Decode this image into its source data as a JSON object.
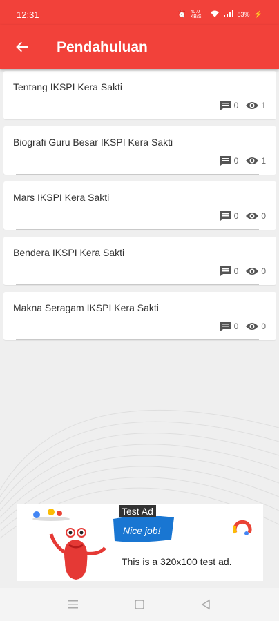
{
  "status_bar": {
    "time": "12:31",
    "battery": "83%",
    "speed": "40.0 KB/S"
  },
  "app_bar": {
    "title": "Pendahuluan"
  },
  "items": [
    {
      "title": "Tentang IKSPI Kera Sakti",
      "comments": "0",
      "views": "1"
    },
    {
      "title": "Biografi Guru Besar IKSPI Kera Sakti",
      "comments": "0",
      "views": "1"
    },
    {
      "title": "Mars IKSPI Kera Sakti",
      "comments": "0",
      "views": "0"
    },
    {
      "title": "Bendera IKSPI Kera Sakti",
      "comments": "0",
      "views": "0"
    },
    {
      "title": "Makna Seragam IKSPI Kera Sakti",
      "comments": "0",
      "views": "0"
    }
  ],
  "ad": {
    "badge": "Test Ad",
    "text": "This is a 320x100 test ad.",
    "flag_text": "Nice job!"
  },
  "colors": {
    "primary": "#f2413a",
    "background": "#efefef"
  },
  "icons": {
    "back": "arrow-back-icon",
    "comment": "comment-icon",
    "views": "eye-icon"
  }
}
